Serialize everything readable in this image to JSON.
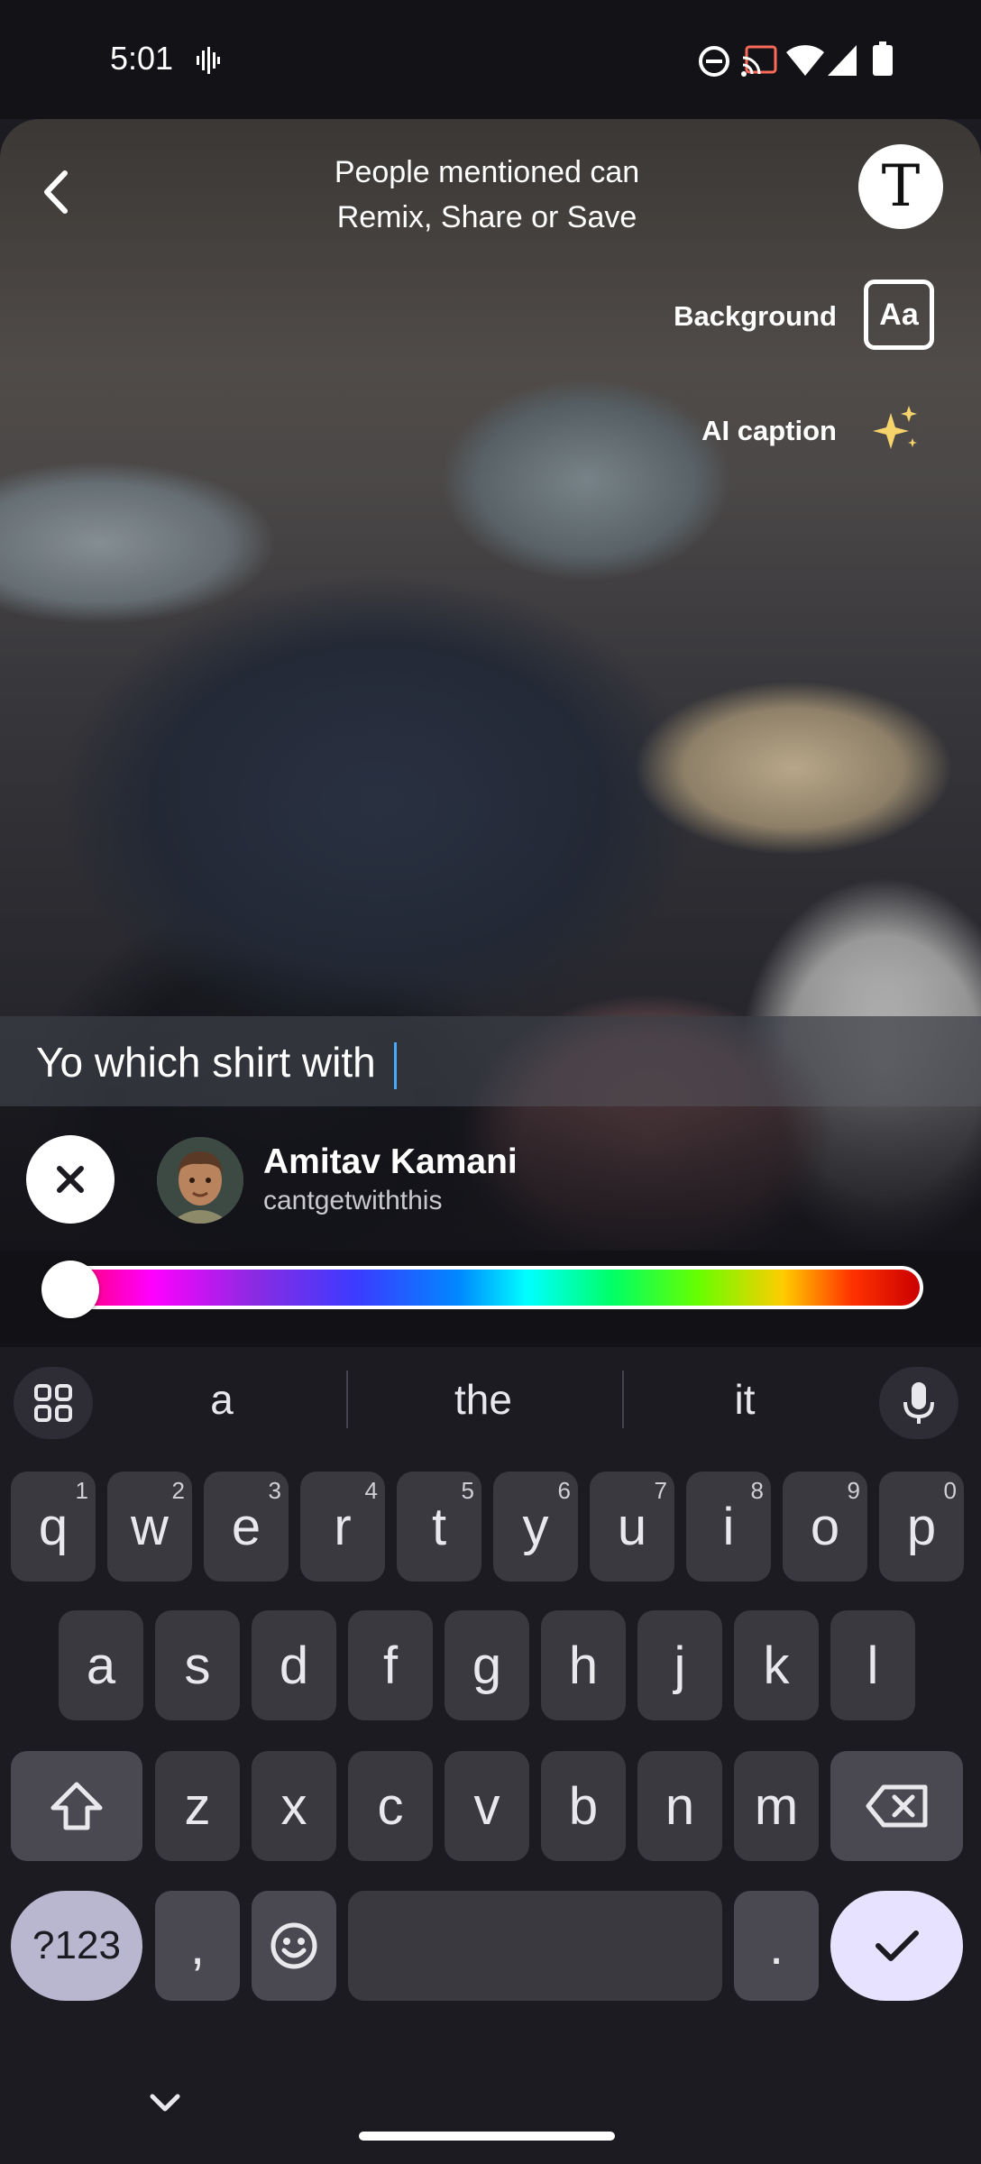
{
  "status_bar": {
    "time": "5:01",
    "icons": [
      "sound-wave-icon",
      "dnd-icon",
      "cast-icon",
      "wifi-icon",
      "signal-icon",
      "battery-icon"
    ]
  },
  "header": {
    "line1": "People mentioned can",
    "line2": "Remix, Share or Save"
  },
  "options": {
    "background_label": "Background",
    "background_icon_text": "Aa",
    "ai_caption_label": "AI caption",
    "text_tool_icon": "T"
  },
  "caption": {
    "text": "Yo which shirt with "
  },
  "mention": {
    "name": "Amitav Kamani",
    "username": "cantgetwiththis"
  },
  "color_slider": {
    "value": 0
  },
  "keyboard": {
    "suggestions": [
      "a",
      "the",
      "it"
    ],
    "row1": [
      {
        "k": "q",
        "h": "1"
      },
      {
        "k": "w",
        "h": "2"
      },
      {
        "k": "e",
        "h": "3"
      },
      {
        "k": "r",
        "h": "4"
      },
      {
        "k": "t",
        "h": "5"
      },
      {
        "k": "y",
        "h": "6"
      },
      {
        "k": "u",
        "h": "7"
      },
      {
        "k": "i",
        "h": "8"
      },
      {
        "k": "o",
        "h": "9"
      },
      {
        "k": "p",
        "h": "0"
      }
    ],
    "row2": [
      "a",
      "s",
      "d",
      "f",
      "g",
      "h",
      "j",
      "k",
      "l"
    ],
    "row3": [
      "z",
      "x",
      "c",
      "v",
      "b",
      "n",
      "m"
    ],
    "symbols_label": "?123",
    "comma": ",",
    "period": "."
  },
  "colors": {
    "photo_overlay": "#26262c",
    "accent_cursor": "#4aa8ff",
    "ok_key": "#e7e2ff"
  }
}
